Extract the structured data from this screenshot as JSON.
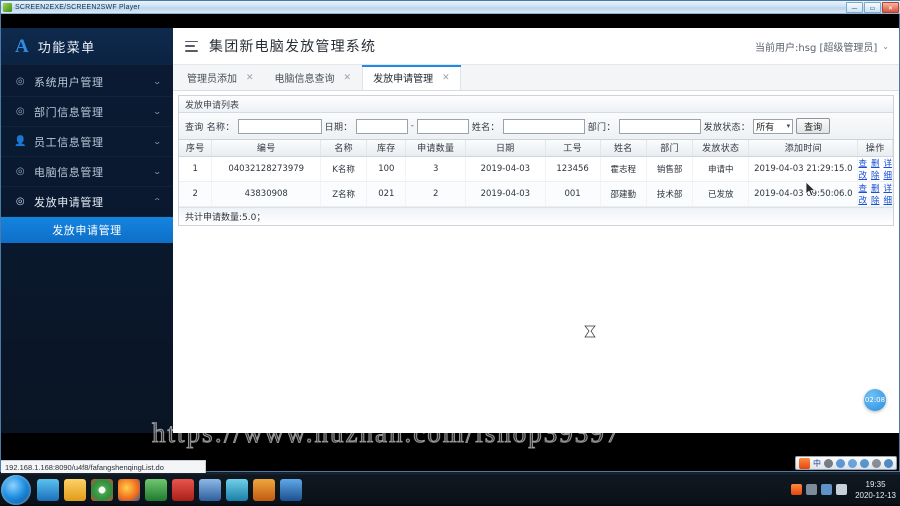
{
  "player_window": {
    "title": "SCREEN2EXE/SCREEN2SWF Player",
    "icon": "player-icon",
    "buttons": {
      "minimize": "—",
      "maximize": "▭",
      "close": "✕"
    }
  },
  "sidebar": {
    "brand": {
      "logo": "A",
      "name": "功能菜单"
    },
    "items": [
      {
        "label": "系统用户管理",
        "icon": "circle-plus-icon",
        "arrow": "⌄"
      },
      {
        "label": "部门信息管理",
        "icon": "circle-plus-icon",
        "arrow": "⌄"
      },
      {
        "label": "员工信息管理",
        "icon": "user-icon",
        "arrow": "⌄"
      },
      {
        "label": "电脑信息管理",
        "icon": "circle-plus-icon",
        "arrow": "⌄"
      },
      {
        "label": "发放申请管理",
        "icon": "circle-plus-icon",
        "arrow": "⌃",
        "expanded": true
      }
    ],
    "submenu": [
      {
        "label": "发放申请管理",
        "active": true
      }
    ]
  },
  "topbar": {
    "menu_icon": "hamburger-icon",
    "title": "集团新电脑发放管理系统",
    "user_text": "当前用户:hsg [超级管理员]",
    "caret": "⌄"
  },
  "tabs": [
    {
      "label": "管理员添加",
      "close": "✕",
      "active": false
    },
    {
      "label": "电脑信息查询",
      "close": "✕",
      "active": false
    },
    {
      "label": "发放申请管理",
      "close": "✕",
      "active": true
    }
  ],
  "panel": {
    "head_title": "发放申请列表"
  },
  "filters": {
    "name_label": "查询 名称：",
    "name_value": "",
    "date_label": "日期：",
    "date_from": "",
    "date_sep": "-",
    "date_to": "",
    "person_label": "姓名：",
    "person_value": "",
    "dept_label": "部门：",
    "dept_value": "",
    "status_label": "发放状态：",
    "status_value": "所有",
    "status_arrow": "▾",
    "query_button": "查询"
  },
  "table": {
    "headers": [
      "序号",
      "编号",
      "名称",
      "库存",
      "申请数量",
      "日期",
      "工号",
      "姓名",
      "部门",
      "发放状态",
      "添加时间",
      "操作"
    ],
    "rows": [
      {
        "seq": "1",
        "code": "04032128273979",
        "name": "K名称",
        "stock": "100",
        "qty": "3",
        "date": "2019-04-03",
        "job_no": "123456",
        "person": "霍志程",
        "dept": "销售部",
        "status": "申请中",
        "added": "2019-04-03 21:29:15.0",
        "ops": [
          "查改",
          "删除",
          "详细"
        ]
      },
      {
        "seq": "2",
        "code": "43830908",
        "name": "Z名称",
        "stock": "021",
        "qty": "2",
        "date": "2019-04-03",
        "job_no": "001",
        "person": "邵建勤",
        "dept": "技术部",
        "status": "已发放",
        "added": "2019-04-03 09:50:06.0",
        "ops": [
          "查改",
          "删除",
          "详细"
        ]
      }
    ],
    "total_text": "共计申请数量:5.0；"
  },
  "fab": {
    "label": "02:08"
  },
  "statusbar": {
    "url": "192.168.1.168:8090/u4f8/fafangshenqingList.do"
  },
  "watermark": {
    "text": "https://www.huzhan.com/ishop39397"
  },
  "taskbar": {
    "start": "start-orb",
    "pinned": [
      "browser-icon",
      "folder-icon",
      "chrome-icon",
      "firefox-icon",
      "player-icon",
      "editor-icon",
      "photo-icon",
      "mail-icon",
      "app-icon",
      "shield-icon"
    ],
    "clock_time": "19:35",
    "clock_date": "2020-12-13"
  },
  "ime": {
    "logo": "sogou-icon",
    "mode": "中",
    "tools": [
      "mic-icon",
      "emoji-icon",
      "keyboard-icon",
      "screenshot-icon",
      "translate-icon",
      "settings-icon"
    ]
  },
  "colors": {
    "sidebar_bg": "#0a1930",
    "accent": "#1484e0",
    "link": "#1a4fd6",
    "header_text": "#2a2f36"
  }
}
